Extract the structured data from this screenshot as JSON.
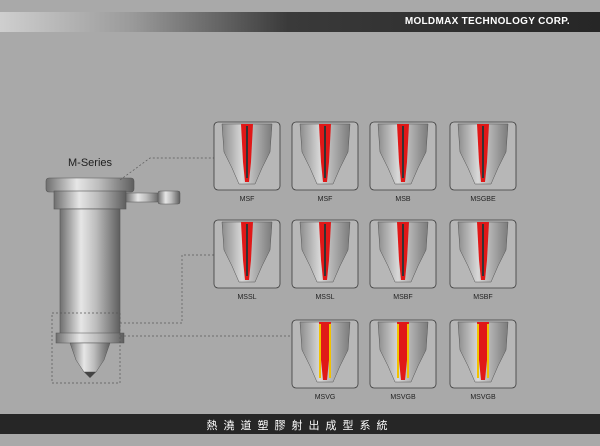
{
  "header": {
    "company": "MOLDMAX TECHNOLOGY CORP."
  },
  "main": {
    "series_label": "M-Series",
    "rows": [
      {
        "nozzles": [
          {
            "label": "MSF",
            "icon": "open-gate-nozzle-icon"
          },
          {
            "label": "MSF",
            "icon": "open-gate-nozzle-icon"
          },
          {
            "label": "MSB",
            "icon": "open-gate-nozzle-icon"
          },
          {
            "label": "MSGBE",
            "icon": "open-gate-nozzle-icon"
          }
        ]
      },
      {
        "nozzles": [
          {
            "label": "MSSL",
            "icon": "open-gate-nozzle-icon"
          },
          {
            "label": "MSSL",
            "icon": "open-gate-nozzle-icon"
          },
          {
            "label": "MSBF",
            "icon": "open-gate-nozzle-icon"
          },
          {
            "label": "MSBF",
            "icon": "open-gate-nozzle-icon"
          }
        ]
      },
      {
        "nozzles": [
          {
            "label": "MSVG",
            "icon": "valve-gate-nozzle-icon"
          },
          {
            "label": "MSVGB",
            "icon": "valve-gate-nozzle-icon"
          },
          {
            "label": "MSVGB",
            "icon": "valve-gate-nozzle-icon"
          }
        ]
      }
    ]
  },
  "footer": {
    "title": "熱澆道塑膠射出成型系統"
  },
  "colors": {
    "melt_red": "#e01818",
    "gate_yellow": "#f2c200",
    "steel": "#b5b5b5",
    "banner_dark": "#262626"
  }
}
